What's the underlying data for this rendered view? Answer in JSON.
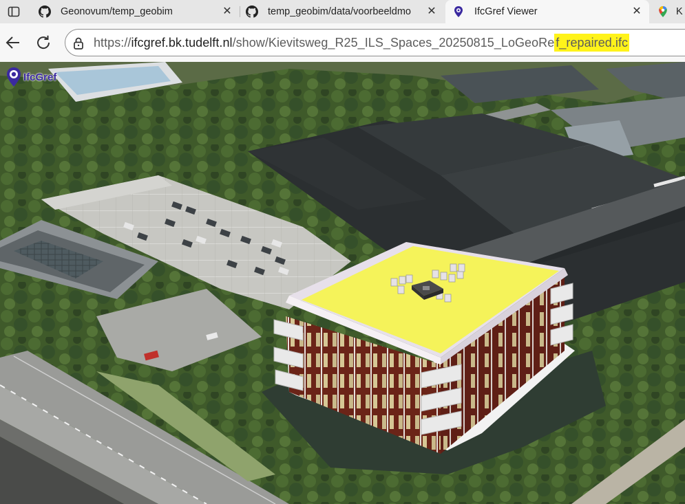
{
  "tabs": [
    {
      "title": "Geonovum/temp_geobim",
      "icon": "github-icon",
      "close": "✕"
    },
    {
      "title": "temp_geobim/data/voorbeeldmo",
      "icon": "github-icon",
      "close": "✕"
    },
    {
      "title": "IfcGref Viewer",
      "icon": "ifcgref-icon",
      "close": "✕",
      "active": true
    },
    {
      "title": "K",
      "icon": "google-maps-icon"
    }
  ],
  "address_bar": {
    "url_scheme": "https://",
    "url_host": "ifcgref.bk.tudelft.nl",
    "url_path": "/show/Kievitsweg_R25_ILS_Spaces_20250815_LoGeoRe",
    "url_highlighted": "f_repaired.ifc",
    "highlight_color": "#fff31a"
  },
  "viewer": {
    "logo_text": "IfcGref",
    "accent_color": "#3b2aa0",
    "roof_color": "#f5f35a",
    "facade_color": "#6e2418"
  }
}
